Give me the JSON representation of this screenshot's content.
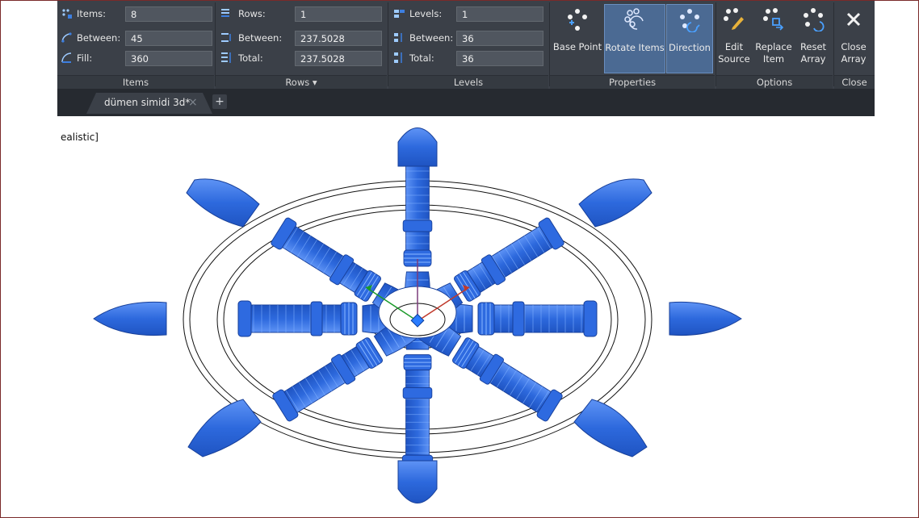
{
  "ribbon": {
    "items_panel": {
      "title": "Items",
      "items_label": "Items:",
      "items_value": "8",
      "between_label": "Between:",
      "between_value": "45",
      "fill_label": "Fill:",
      "fill_value": "360"
    },
    "rows_panel": {
      "title": "Rows",
      "rows_label": "Rows:",
      "rows_value": "1",
      "between_label": "Between:",
      "between_value": "237.5028",
      "total_label": "Total:",
      "total_value": "237.5028",
      "dropdown_glyph": "▾"
    },
    "levels_panel": {
      "title": "Levels",
      "levels_label": "Levels:",
      "levels_value": "1",
      "between_label": "Between:",
      "between_value": "36",
      "total_label": "Total:",
      "total_value": "36"
    },
    "properties_panel": {
      "title": "Properties",
      "base_point": "Base Point",
      "rotate_items": "Rotate Items",
      "direction": "Direction"
    },
    "options_panel": {
      "title": "Options",
      "edit_source_1": "Edit",
      "edit_source_2": "Source",
      "replace_item_1": "Replace",
      "replace_item_2": "Item",
      "reset_array_1": "Reset",
      "reset_array_2": "Array"
    },
    "close_panel": {
      "title": "Close",
      "close_array_1": "Close",
      "close_array_2": "Array"
    }
  },
  "tabs": {
    "document_tab": "dümen simidi 3d*",
    "close_glyph": "×",
    "new_tab_glyph": "+"
  },
  "viewport": {
    "visual_style_label": "ealistic]"
  },
  "colors": {
    "ribbon_bg": "#3b4048",
    "selection_blue": "#2f6fe0",
    "active_button": "#4b6a93"
  }
}
